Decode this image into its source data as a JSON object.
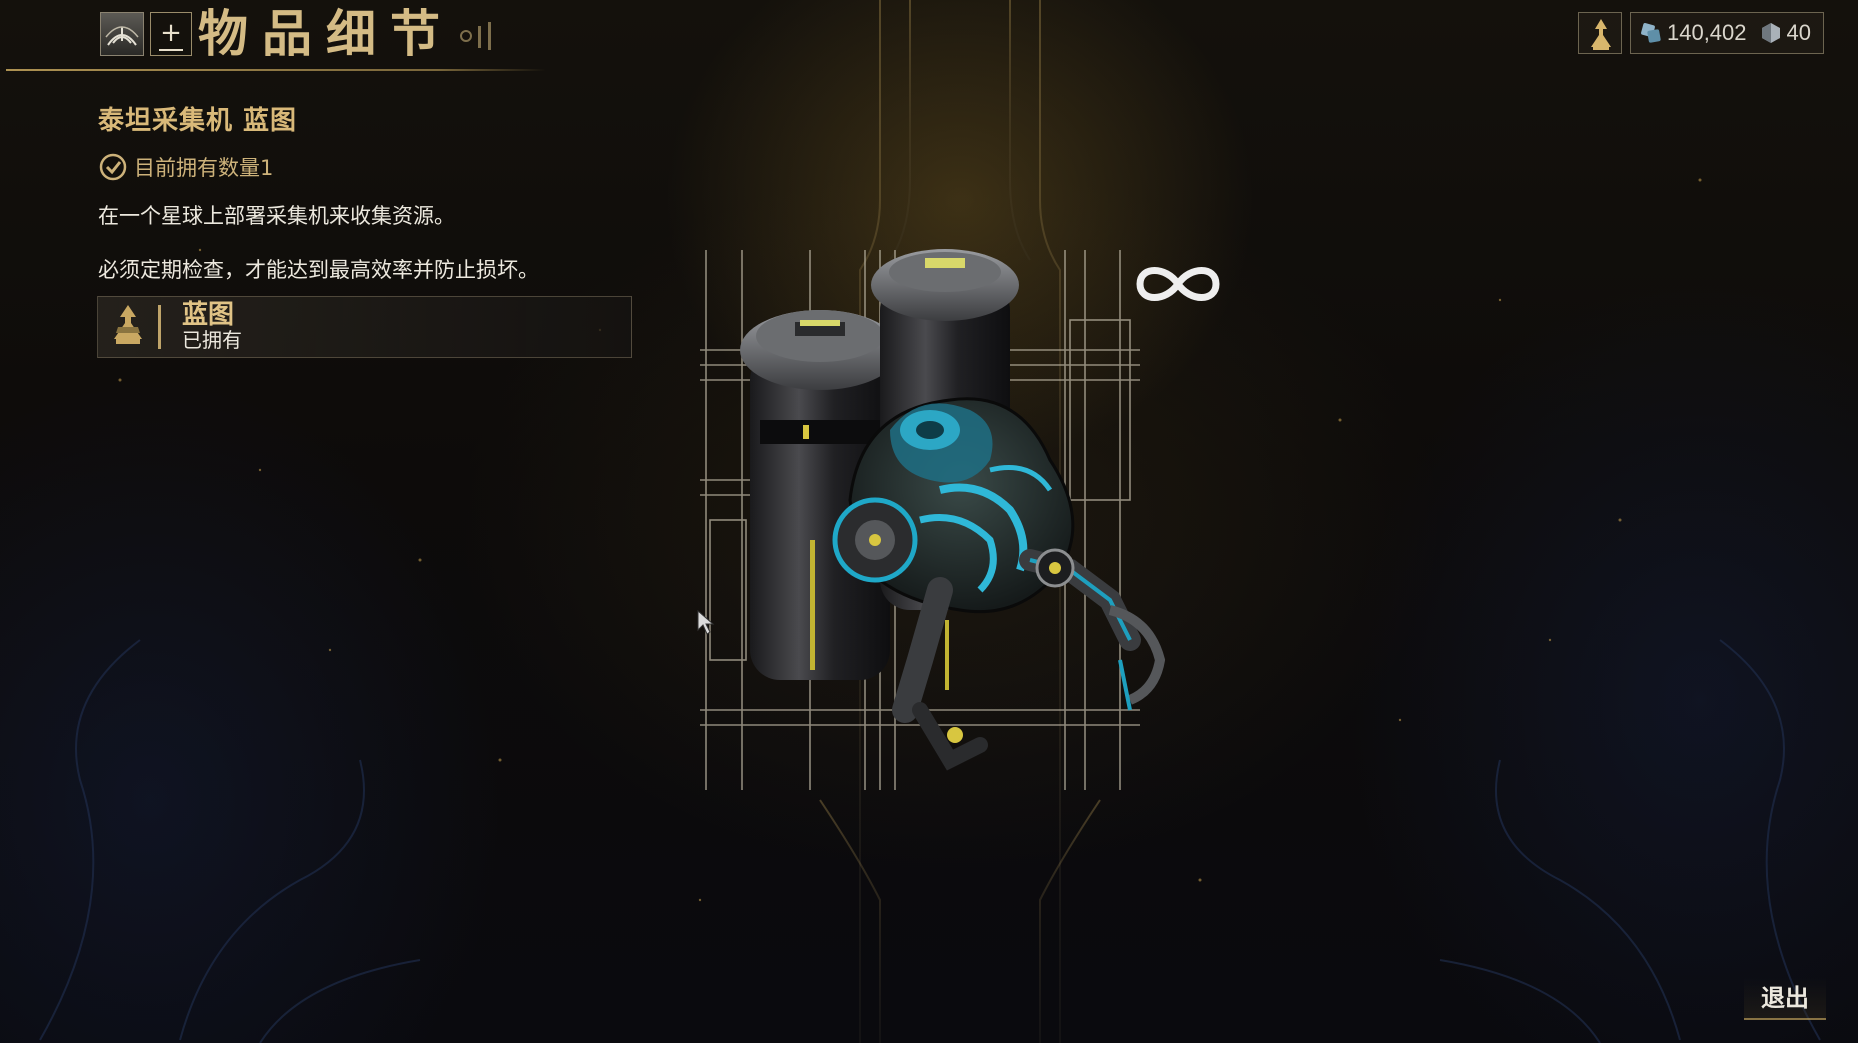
{
  "header": {
    "title": "物品细节",
    "home_icon": "lotus-icon",
    "plus_label": "+"
  },
  "currency": {
    "profile_icon": "profile-rank-icon",
    "credits": "140,402",
    "credits_icon": "credits-icon",
    "platinum": "40",
    "platinum_icon": "platinum-icon"
  },
  "item": {
    "name": "泰坦采集机 蓝图",
    "owned_text": "目前拥有数量1",
    "description_1": "在一个星球上部署采集机来收集资源。",
    "description_2": "必须定期检查，才能达到最高效率并防止损坏。",
    "blueprint_title": "蓝图",
    "blueprint_status": "已拥有",
    "uses_icon": "infinity-icon"
  },
  "footer": {
    "exit_label": "退出"
  },
  "colors": {
    "accent_gold": "#d4bb85",
    "text_light": "#ece8de",
    "cyan_highlight": "#2fb8d8"
  }
}
